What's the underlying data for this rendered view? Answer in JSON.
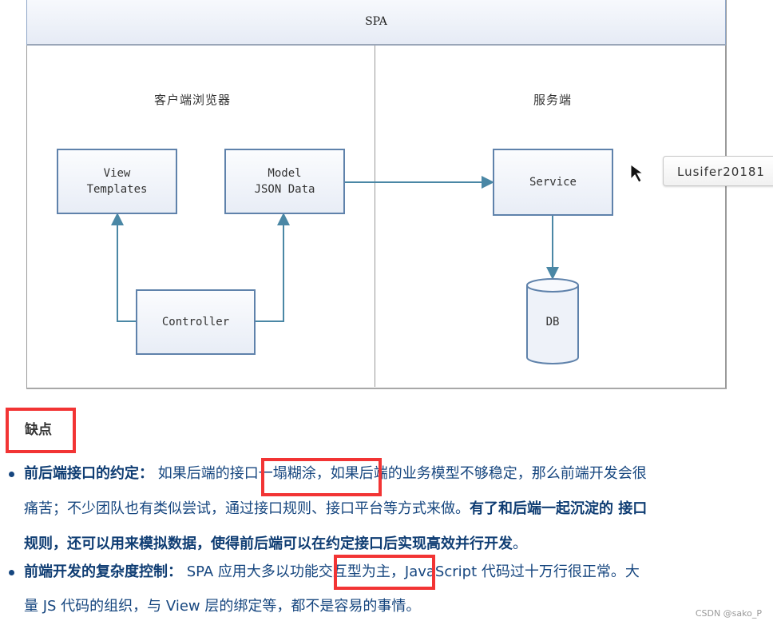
{
  "diagram": {
    "title": "SPA",
    "client_lane": "客户端浏览器",
    "server_lane": "服务端",
    "boxes": {
      "view": [
        "View",
        "Templates"
      ],
      "model": [
        "Model",
        "JSON Data"
      ],
      "controller": "Controller",
      "service": "Service",
      "db": "DB"
    },
    "tooltip": "Lusifer20181",
    "colors": {
      "box_border": "#5f82ab",
      "arrow": "#4a87a5"
    }
  },
  "section": {
    "heading": "缺点",
    "items": [
      {
        "label": "前后端接口的约定：",
        "line1_a": "如果后端的",
        "line1_hl": "接口一塌糊涂",
        "line1_b": "，如果后端的业务模型不够稳定，那么前端开发会很",
        "line2_a": "痛苦；不少团队也有类似尝试，通过接口规则、接口平台等方式来做。",
        "line2_bold": "有了和后端一起沉淀的 接口",
        "line3_bold": "规则，还可以用来模拟数据，使得前后端可以在约定接口后实现高效并行开发",
        "line3_end": "。"
      },
      {
        "label": "前端开发的复杂度控制：",
        "line1_a": "SPA 应用大多以",
        "line1_hl": "功能交互型",
        "line1_b": "为主，JavaScript 代码过十万行很正常。大",
        "line2": "量 JS 代码的组织，与 View 层的绑定等，都不是容易的事情。"
      }
    ]
  },
  "watermark": "CSDN @sako_P",
  "highlight_color": "#f23434",
  "text_color": "#16467f"
}
